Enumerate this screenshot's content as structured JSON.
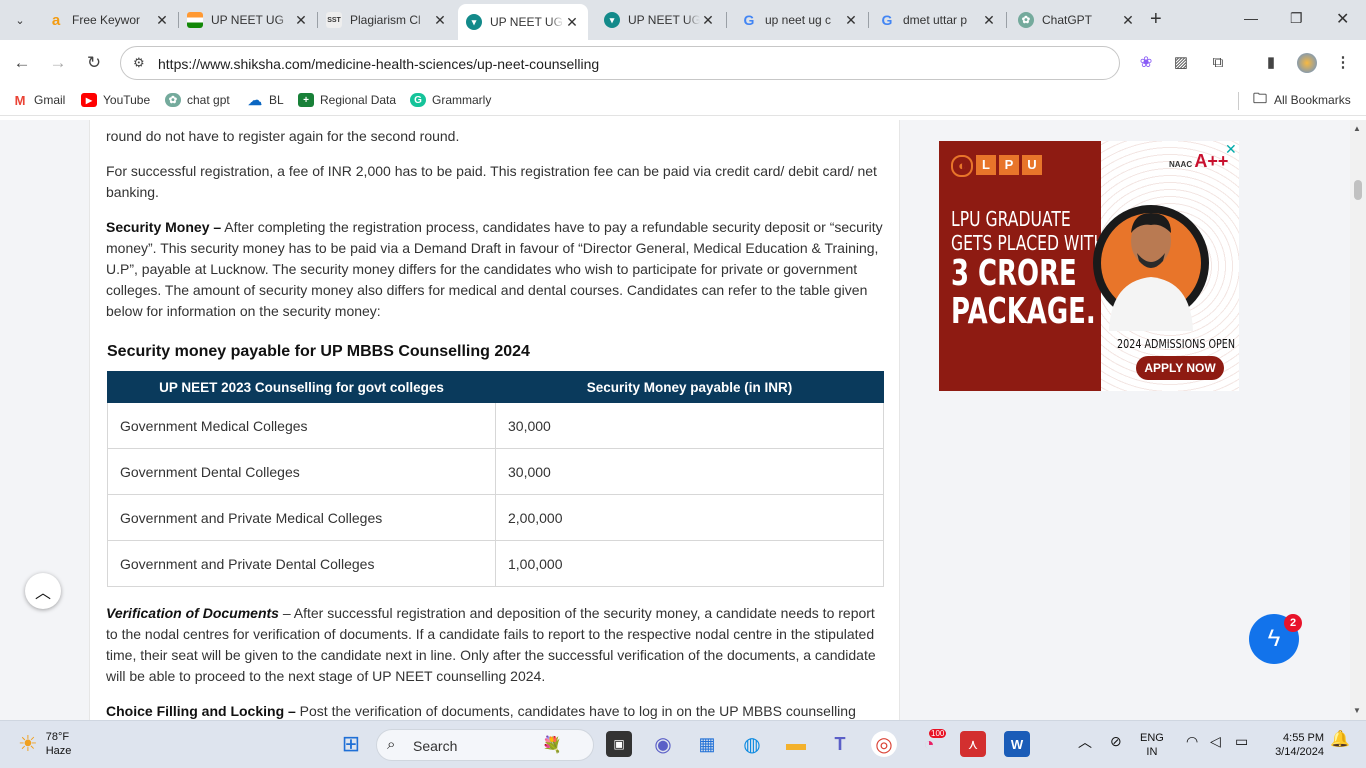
{
  "browser": {
    "tabs": [
      {
        "title": "Free Keywor",
        "favicon": "a",
        "color": "#f39c12"
      },
      {
        "title": "UP NEET UG",
        "favicon": "flag",
        "color": "#ff9933"
      },
      {
        "title": "Plagiarism Cl",
        "favicon": "SST",
        "color": "#d9d9d9"
      },
      {
        "title": "UP NEET UG",
        "favicon": "shiksha",
        "color": "#138a8a",
        "active": true
      },
      {
        "title": "UP NEET UG",
        "favicon": "shiksha",
        "color": "#138a8a"
      },
      {
        "title": "up neet ug c",
        "favicon": "G",
        "color": "#4285f4"
      },
      {
        "title": "dmet uttar p",
        "favicon": "G",
        "color": "#4285f4"
      },
      {
        "title": "ChatGPT",
        "favicon": "gpt",
        "color": "#74aa9c"
      }
    ],
    "url": "https://www.shiksha.com/medicine-health-sciences/up-neet-counselling",
    "bookmarks": [
      {
        "label": "Gmail"
      },
      {
        "label": "YouTube"
      },
      {
        "label": "chat gpt"
      },
      {
        "label": "BL"
      },
      {
        "label": "Regional Data"
      },
      {
        "label": "Grammarly"
      }
    ],
    "all_bookmarks": "All Bookmarks"
  },
  "article": {
    "p1": "round do not have to register again for the second round.",
    "p2": "For successful registration, a fee of INR 2,000 has to be paid. This registration fee can be paid via credit card/ debit card/ net banking.",
    "p3_lead": "Security Money –",
    "p3": " After completing the registration process, candidates have to pay a refundable security deposit or “security money”. This security money has to be paid via a Demand Draft in favour of “Director General, Medical Education & Training, U.P”, payable at Lucknow. The security money differs for the candidates who wish to participate for private or government colleges. The amount of security money also differs for medical and dental courses. Candidates can refer to the table given below for information on the security money:",
    "section_title": "Security money payable for UP MBBS Counselling 2024",
    "table": {
      "headers": [
        "UP NEET 2023 Counselling for govt colleges",
        "Security Money payable (in INR)"
      ],
      "rows": [
        [
          "Government Medical Colleges",
          "30,000"
        ],
        [
          "Government Dental Colleges",
          "30,000"
        ],
        [
          "Government and Private Medical Colleges",
          "2,00,000"
        ],
        [
          "Government and Private Dental Colleges",
          "1,00,000"
        ]
      ]
    },
    "p4_lead": "Verification of Documents",
    "p4": " – After successful registration and deposition of the security money, a candidate needs to report to the nodal centres for verification of documents. If a candidate fails to report to the respective nodal centre in the stipulated time, their seat will be given to the candidate next in line. Only after the successful verification of the documents, a candidate will be able to proceed to the next stage of UP NEET counselling 2024.",
    "p5_lead": "Choice Filling and Locking –",
    "p5": " Post the verification of documents, candidates have to log in on the UP MBBS counselling"
  },
  "ad": {
    "logo_letters": [
      "L",
      "P",
      "U"
    ],
    "headline": [
      "LPU GRADUATE",
      "GETS PLACED WITH"
    ],
    "big": [
      "3 CRORE",
      "PACKAGE."
    ],
    "naac": "A++",
    "admissions": "2024 ADMISSIONS OPEN",
    "cta": "APPLY NOW"
  },
  "chat_badge": "2",
  "taskbar": {
    "temp": "78°F",
    "weather": "Haze",
    "search": "Search",
    "lang1": "ENG",
    "lang2": "IN",
    "time": "4:55 PM",
    "date": "3/14/2024",
    "notif_count": "100"
  }
}
